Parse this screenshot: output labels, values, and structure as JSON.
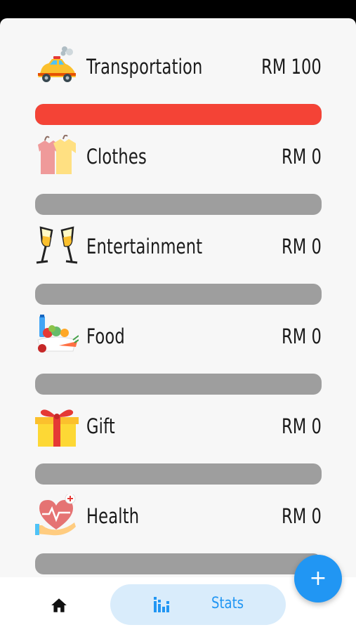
{
  "colors": {
    "over_budget": "#f44336",
    "track": "#9e9e9e",
    "accent": "#2196f3",
    "stats_pill_bg": "#d9ecfb"
  },
  "categories": [
    {
      "name": "Transportation",
      "amount": "RM 100",
      "icon": "car-icon",
      "progress": 1.0
    },
    {
      "name": "Clothes",
      "amount": "RM 0",
      "icon": "clothes-icon",
      "progress": 0
    },
    {
      "name": "Entertainment",
      "amount": "RM 0",
      "icon": "champagne-icon",
      "progress": 0
    },
    {
      "name": "Food",
      "amount": "RM 0",
      "icon": "food-icon",
      "progress": 0
    },
    {
      "name": "Gift",
      "amount": "RM 0",
      "icon": "gift-icon",
      "progress": 0
    },
    {
      "name": "Health",
      "amount": "RM 0",
      "icon": "health-heart-icon",
      "progress": 0
    }
  ],
  "bottom_nav": {
    "home_icon": "home-icon",
    "stats_icon": "bar-chart-icon",
    "stats_label": "Stats"
  },
  "fab": {
    "icon": "plus-icon",
    "label": "+"
  }
}
